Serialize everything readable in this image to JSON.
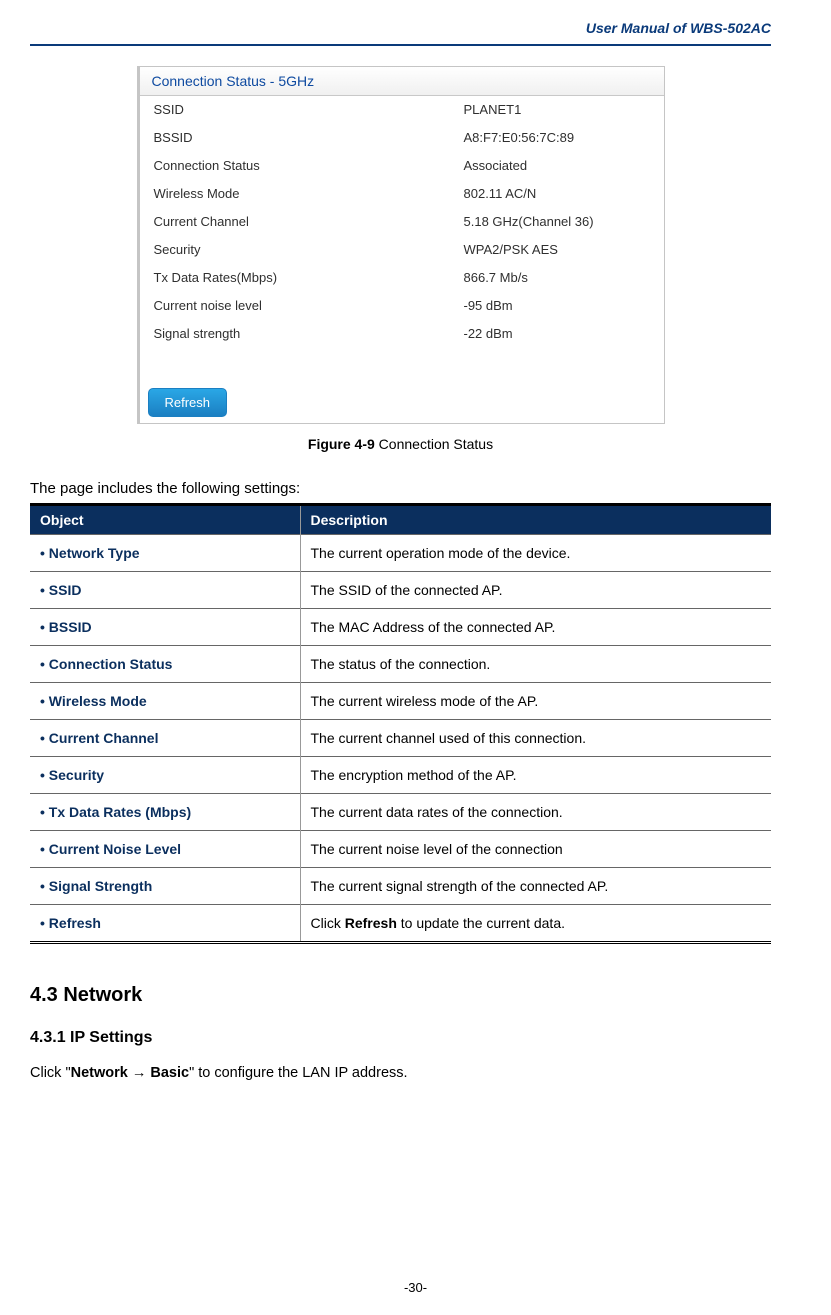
{
  "header": "User Manual of WBS-502AC",
  "shot": {
    "title": "Connection Status - 5GHz",
    "rows": [
      {
        "k": "SSID",
        "v": "PLANET1"
      },
      {
        "k": "BSSID",
        "v": "A8:F7:E0:56:7C:89"
      },
      {
        "k": "Connection Status",
        "v": "Associated"
      },
      {
        "k": "Wireless Mode",
        "v": "802.11 AC/N"
      },
      {
        "k": "Current Channel",
        "v": "5.18 GHz(Channel 36)"
      },
      {
        "k": "Security",
        "v": "WPA2/PSK AES"
      },
      {
        "k": "Tx Data Rates(Mbps)",
        "v": "866.7 Mb/s"
      },
      {
        "k": "Current noise level",
        "v": "-95 dBm"
      },
      {
        "k": "Signal strength",
        "v": "-22 dBm"
      }
    ],
    "refresh": "Refresh"
  },
  "figure": {
    "bold": "Figure 4-9",
    "rest": " Connection Status"
  },
  "intro": "The page includes the following settings:",
  "table": {
    "head": {
      "obj": "Object",
      "desc": "Description"
    },
    "rows": [
      {
        "obj": "Network Type",
        "desc": "The current operation mode of the device."
      },
      {
        "obj": "SSID",
        "desc": "The SSID of the connected AP."
      },
      {
        "obj": "BSSID",
        "desc": "The MAC Address of the connected AP."
      },
      {
        "obj": "Connection Status",
        "desc": "The status of the connection."
      },
      {
        "obj": "Wireless Mode",
        "desc": "The current wireless mode of the AP."
      },
      {
        "obj": "Current Channel",
        "desc": "The current channel used of this connection."
      },
      {
        "obj": "Security",
        "desc": "The encryption method of the AP."
      },
      {
        "obj": "Tx Data Rates (Mbps)",
        "desc": "The current data rates of the connection."
      },
      {
        "obj": "Current Noise Level",
        "desc": "The current noise level of the connection"
      },
      {
        "obj": "Signal Strength",
        "desc": "The current signal strength of the connected AP."
      },
      {
        "obj": "Refresh",
        "desc_pre": "Click ",
        "desc_bold": "Refresh",
        "desc_post": " to update the current data.",
        "isRefresh": true
      }
    ]
  },
  "sec43": "4.3  Network",
  "sec431": "4.3.1  IP Settings",
  "para": {
    "pre": "Click \"",
    "bold": "Network → Basic",
    "post": "\" to configure the LAN IP address."
  },
  "footer": "-30-"
}
